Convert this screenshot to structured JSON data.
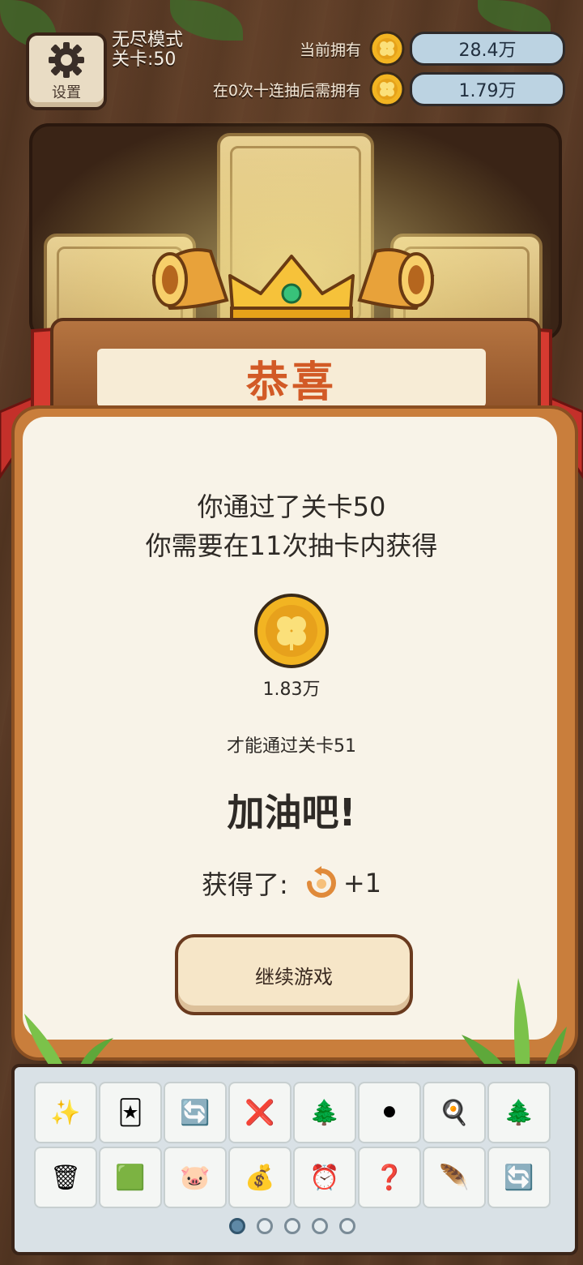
{
  "header": {
    "settings_label": "设置",
    "mode_line1": "无尽模式",
    "mode_line2": "关卡:50",
    "current_label": "当前拥有",
    "current_value": "28.4万",
    "required_label": "在0次十连抽后需拥有",
    "required_value": "1.79万"
  },
  "dialog": {
    "title": "恭喜",
    "line1": "你通过了关卡50",
    "line2": "你需要在11次抽卡内获得",
    "coin_amount": "1.83万",
    "line3": "才能通过关卡51",
    "cheer": "加油吧!",
    "reward_label": "获得了:",
    "reward_value": "+1",
    "continue_label": "继续游戏"
  },
  "toolbar": {
    "items": [
      {
        "name": "sparkle-item-icon",
        "glyph": "✨"
      },
      {
        "name": "coin-cards-x2-icon",
        "glyph": "🃏"
      },
      {
        "name": "swap-arrows-icon",
        "glyph": "🔄"
      },
      {
        "name": "cross-question-icon",
        "glyph": "❌"
      },
      {
        "name": "fruit-tree-icon",
        "glyph": "🌲"
      },
      {
        "name": "black-hole-icon",
        "glyph": "⚫"
      },
      {
        "name": "frying-pan-icon",
        "glyph": "🍳"
      },
      {
        "name": "fruit-tree-icon-2",
        "glyph": "🌲"
      },
      {
        "name": "trash-coins-icon",
        "glyph": "🗑"
      },
      {
        "name": "green-card-icon",
        "glyph": "🟩"
      },
      {
        "name": "piggy-bank-icon",
        "glyph": "🐷"
      },
      {
        "name": "money-bag-icon",
        "glyph": "💰"
      },
      {
        "name": "alarm-clock-icon",
        "glyph": "⏰"
      },
      {
        "name": "free-question-card-icon",
        "glyph": "❓"
      },
      {
        "name": "feather-icon",
        "glyph": "🪶"
      },
      {
        "name": "swap-arrows-icon-2",
        "glyph": "🔄"
      }
    ]
  },
  "pagination": {
    "active_index": 0,
    "count": 5
  }
}
